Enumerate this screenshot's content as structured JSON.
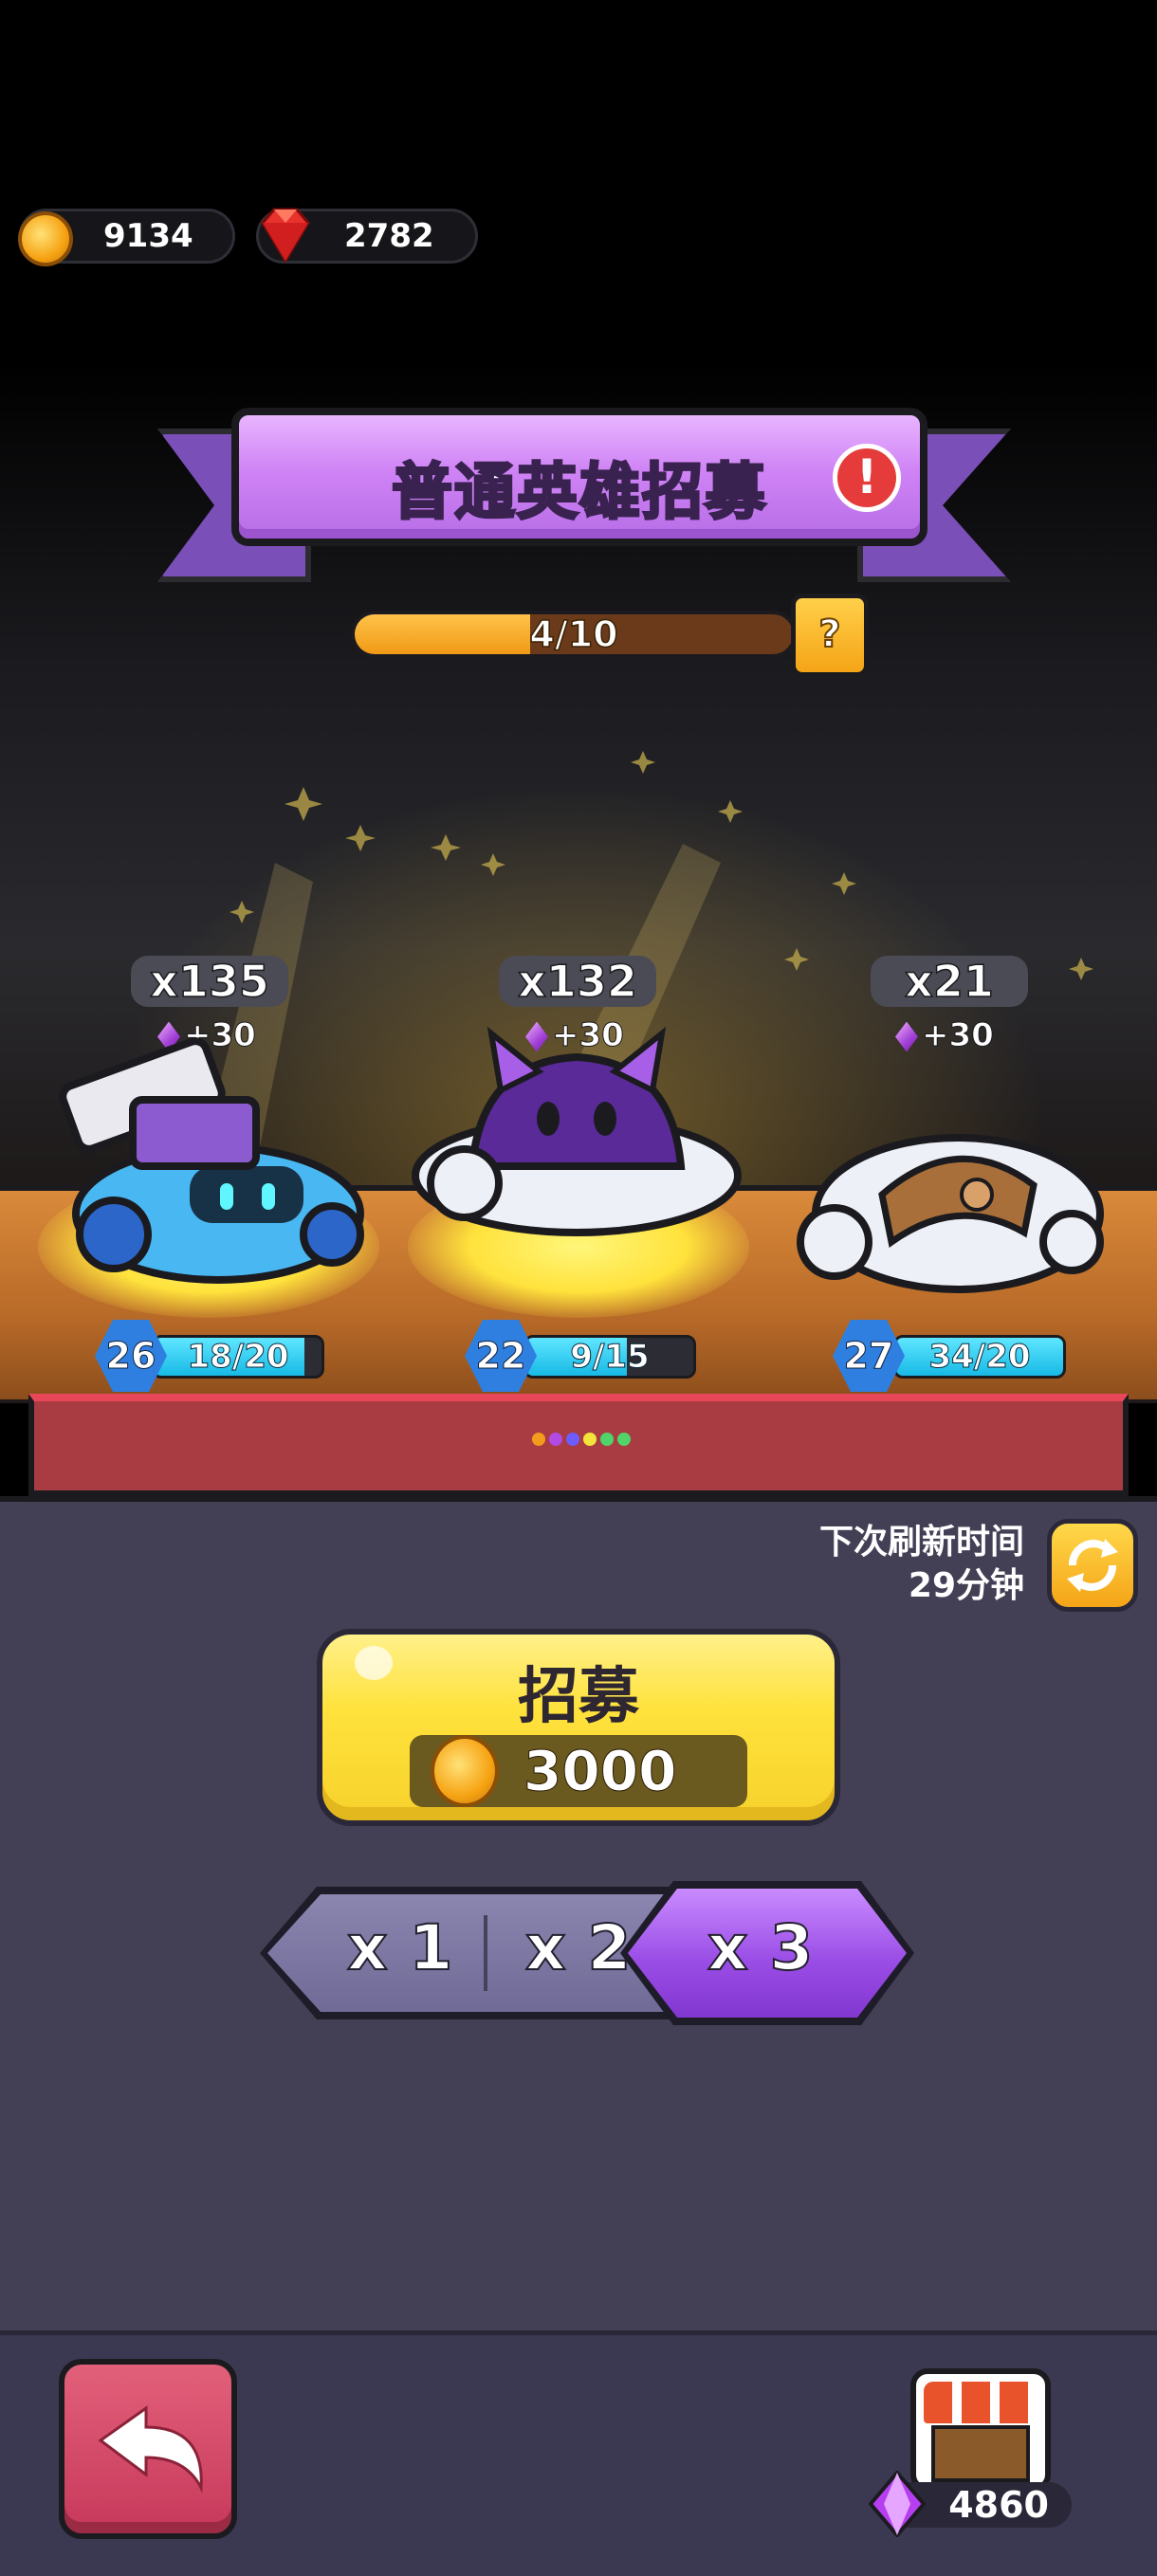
{
  "currency": {
    "coins": "9134",
    "rubies": "2782"
  },
  "banner": {
    "title": "普通英雄招募"
  },
  "progress": {
    "text": "4/10",
    "fraction": 0.4,
    "help": "?"
  },
  "heroes": [
    {
      "count": "x135",
      "bonus": "+30",
      "level": "26",
      "xp": "18/20",
      "xp_fraction": 0.9
    },
    {
      "count": "x132",
      "bonus": "+30",
      "level": "22",
      "xp": "9/15",
      "xp_fraction": 0.6
    },
    {
      "count": "x21",
      "bonus": "+30",
      "level": "27",
      "xp": "34/20",
      "xp_fraction": 1.0
    }
  ],
  "refresh": {
    "line1": "下次刷新时间",
    "line2": "29分钟"
  },
  "recruit": {
    "label": "招募",
    "price": "3000"
  },
  "multipliers": [
    "x 1",
    "x 2",
    "x 3"
  ],
  "selected_multiplier": "x 3",
  "shop": {
    "gems": "4860"
  },
  "colors": {
    "banner": "#cf83f5",
    "recruit": "#ffe23c",
    "selected": "#9b4ee6",
    "back": "#d14a68"
  }
}
